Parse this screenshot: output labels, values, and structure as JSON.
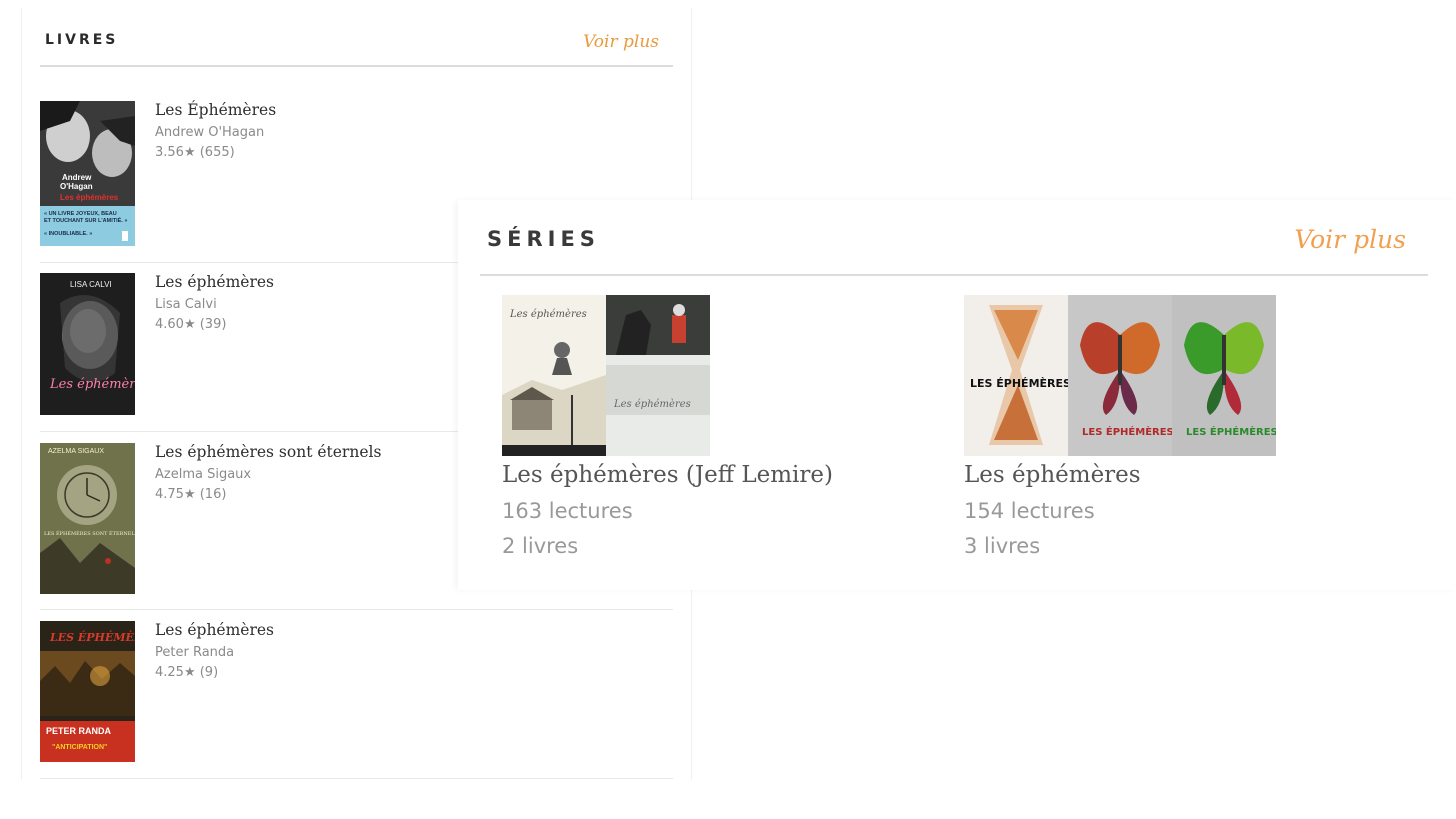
{
  "livres": {
    "title": "LIVRES",
    "see_more": "Voir plus",
    "books": [
      {
        "title": "Les Éphémères",
        "author": "Andrew O'Hagan",
        "rating": "3.56★ (655)",
        "cover_text": [
          "Andrew",
          "O'Hagan",
          "Les éphémères",
          "« UN LIVRE JOYEUX, BEAU",
          "ET TOUCHANT SUR L'AMITIÉ. »",
          "« INOUBLIABLE. »"
        ]
      },
      {
        "title": "Les éphémères",
        "author": "Lisa Calvi",
        "rating": "4.60★ (39)",
        "cover_text": [
          "LISA CALVI",
          "Les éphémères"
        ]
      },
      {
        "title": "Les éphémères sont éternels",
        "author": "Azelma Sigaux",
        "rating": "4.75★ (16)",
        "cover_text": [
          "AZELMA SIGAUX",
          "LES ÉPHÉMÈRES SONT ÉTERNELS"
        ]
      },
      {
        "title": "Les éphémères",
        "author": "Peter Randa",
        "rating": "4.25★ (9)",
        "cover_text": [
          "LES ÉPHÉMÈRES",
          "PETER RANDA",
          "\"ANTICIPATION\""
        ]
      }
    ]
  },
  "series": {
    "title": "SÉRIES",
    "see_more": "Voir plus",
    "items": [
      {
        "name": "Les éphémères (Jeff Lemire)",
        "reads": "163 lectures",
        "books": "2 livres",
        "cover_text": [
          "Les éphémères",
          "Les éphémères"
        ]
      },
      {
        "name": "Les éphémères",
        "reads": "154 lectures",
        "books": "3 livres",
        "cover_text": [
          "LES ÉPHÉMÈRES",
          "LES ÉPHÉMÈRES",
          "LES ÉPHÉMÈRES"
        ]
      }
    ]
  },
  "colors": {
    "accent": "#e89a3c",
    "divider": "#dcdcdc",
    "muted_text": "#8a8a8a"
  }
}
